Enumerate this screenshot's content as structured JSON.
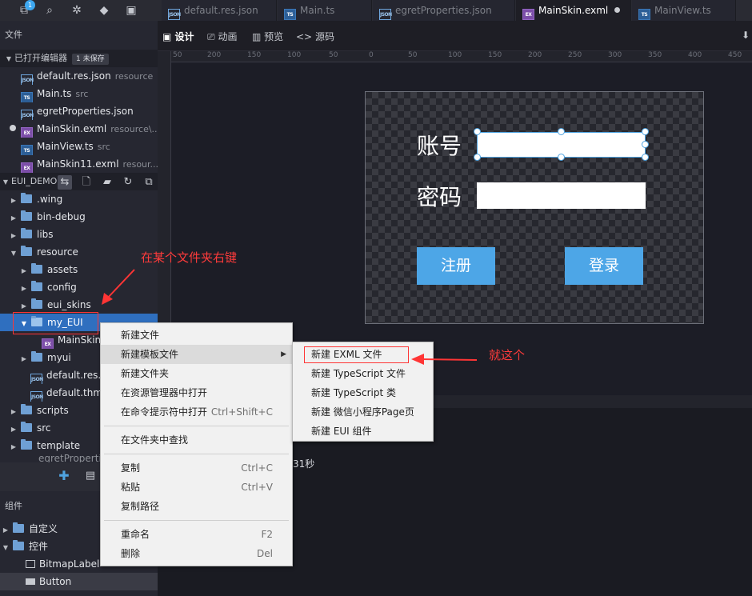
{
  "activity": {
    "badge": "1"
  },
  "tabs": [
    {
      "label": "default.res.json",
      "icon": "json-icon"
    },
    {
      "label": "Main.ts",
      "icon": "ts-icon"
    },
    {
      "label": "egretProperties.json",
      "icon": "json-icon"
    },
    {
      "label": "MainSkin.exml",
      "icon": "exml-icon",
      "active": true,
      "modified": true
    },
    {
      "label": "MainView.ts",
      "icon": "ts-icon"
    }
  ],
  "sidebar": {
    "files_header": "文件",
    "open_editors": {
      "title": "已打开编辑器",
      "unsaved": "1 未保存"
    },
    "open_files": [
      {
        "name": "default.res.json",
        "hint": "resource"
      },
      {
        "name": "Main.ts",
        "hint": "src"
      },
      {
        "name": "egretProperties.json",
        "hint": ""
      },
      {
        "name": "MainSkin.exml",
        "hint": "resource\\..."
      },
      {
        "name": "MainView.ts",
        "hint": "src"
      },
      {
        "name": "MainSkin11.exml",
        "hint": "resour..."
      }
    ],
    "project": {
      "name": "EUI_DEMO"
    },
    "tree": [
      ".wing",
      "bin-debug",
      "libs",
      "resource",
      "assets",
      "config",
      "eui_skins",
      "my_EUI",
      "MainSkin",
      "myui",
      "default.res.j",
      "default.thm",
      "scripts",
      "src",
      "template",
      "egretPropertie"
    ],
    "components_header": "组件",
    "components": [
      {
        "label": "自定义"
      },
      {
        "label": "控件"
      },
      {
        "label": "BitmapLabel"
      },
      {
        "label": "Button"
      }
    ]
  },
  "editor": {
    "modes": [
      "设计",
      "动画",
      "预览",
      "源码"
    ],
    "ruler_ticks": [
      "50",
      "200",
      "150",
      "100",
      "50",
      "0",
      "50",
      "100",
      "150",
      "200",
      "250",
      "300",
      "350",
      "400",
      "450"
    ],
    "stage": {
      "account_label": "账号",
      "password_label": "密码",
      "register_button": "注册",
      "login_button": "登录"
    },
    "console_text": "31秒"
  },
  "context_menu": {
    "items": [
      {
        "label": "新建文件",
        "shortcut": ""
      },
      {
        "label": "新建模板文件",
        "shortcut": ""
      },
      {
        "label": "新建文件夹",
        "shortcut": ""
      },
      {
        "label": "在资源管理器中打开",
        "shortcut": ""
      },
      {
        "label": "在命令提示符中打开",
        "shortcut": "Ctrl+Shift+C"
      },
      {
        "label": "在文件夹中查找",
        "shortcut": ""
      },
      {
        "label": "复制",
        "shortcut": "Ctrl+C"
      },
      {
        "label": "粘贴",
        "shortcut": "Ctrl+V"
      },
      {
        "label": "复制路径",
        "shortcut": ""
      },
      {
        "label": "重命名",
        "shortcut": "F2"
      },
      {
        "label": "删除",
        "shortcut": "Del"
      }
    ]
  },
  "submenu": {
    "items": [
      "新建 EXML 文件",
      "新建 TypeScript 文件",
      "新建 TypeScript 类",
      "新建 微信小程序Page页",
      "新建 EUI 组件"
    ]
  },
  "annotations": {
    "right_click": "在某个文件夹右键",
    "this_one": "就这个"
  },
  "colors": {
    "accent": "#4da6e7",
    "selection": "#2f6fbf",
    "annotation": "#ff3b3b"
  }
}
